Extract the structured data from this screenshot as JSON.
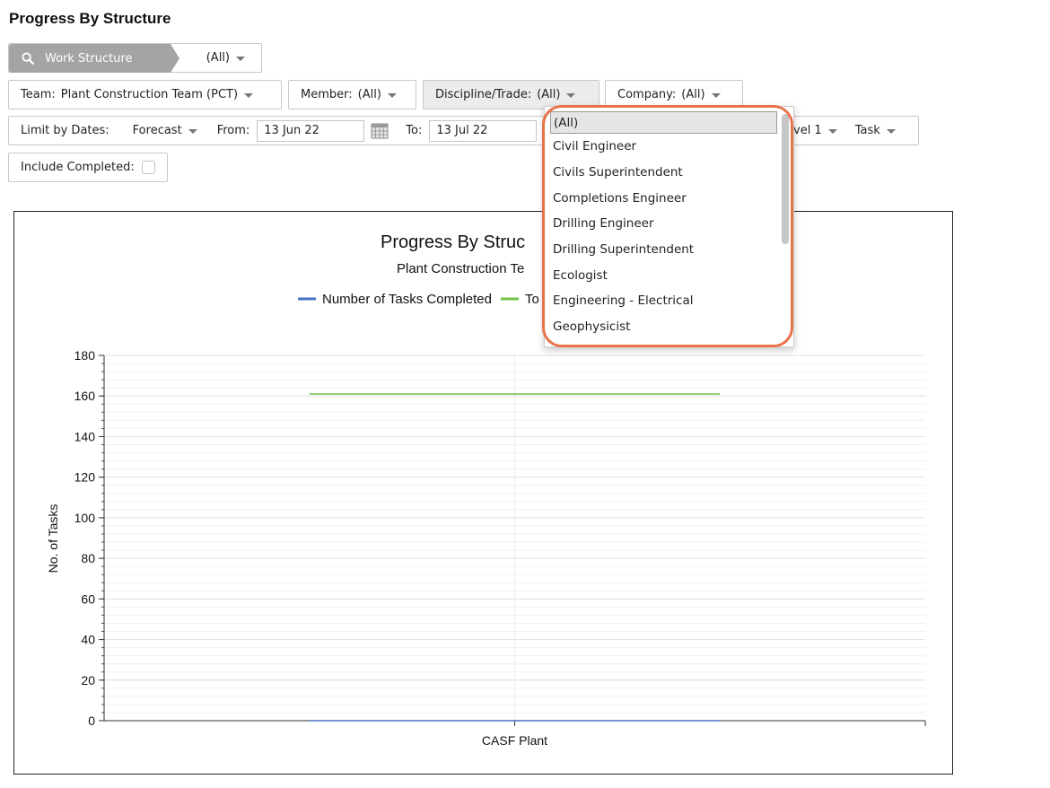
{
  "page": {
    "title": "Progress By Structure"
  },
  "filters": {
    "work_structure": {
      "label": "Work Structure",
      "value": "(All)"
    },
    "team": {
      "label": "Team:",
      "value": "Plant Construction Team (PCT)"
    },
    "member": {
      "label": "Member:",
      "value": "(All)"
    },
    "discipline": {
      "label": "Discipline/Trade:",
      "value": "(All)"
    },
    "company": {
      "label": "Company:",
      "value": "(All)"
    },
    "limit_by_dates": {
      "label": "Limit by Dates:",
      "value": "Forecast"
    },
    "from": {
      "label": "From:",
      "value": "13 Jun 22"
    },
    "to": {
      "label": "To:",
      "value": "13 Jul 22"
    },
    "level": {
      "value": "vel 1"
    },
    "task": {
      "value": "Task"
    },
    "include_completed": {
      "label": "Include Completed:",
      "checked": false
    }
  },
  "discipline_dropdown": {
    "options": [
      "(All)",
      "Civil Engineer",
      "Civils Superintendent",
      "Completions Engineer",
      "Drilling Engineer",
      "Drilling Superintendent",
      "Ecologist",
      "Engineering - Electrical",
      "Geophysicist"
    ],
    "selected_index": 0,
    "highlight_color": "#e8734a"
  },
  "chart_data": {
    "type": "line",
    "title": "Progress By Struc",
    "subtitle": "Plant Construction Te",
    "categories": [
      "CASF Plant"
    ],
    "series": [
      {
        "name": "Number of Tasks Completed",
        "color": "#4472c4",
        "values": [
          0
        ]
      },
      {
        "name": "To",
        "color": "#70c24a",
        "values": [
          161
        ]
      }
    ],
    "ylabel": "No. of Tasks",
    "xlabel": "",
    "ylim": [
      0,
      180
    ],
    "yticks": [
      0,
      20,
      40,
      60,
      80,
      100,
      120,
      140,
      160,
      180
    ],
    "grid": true,
    "legend_position": "top"
  }
}
